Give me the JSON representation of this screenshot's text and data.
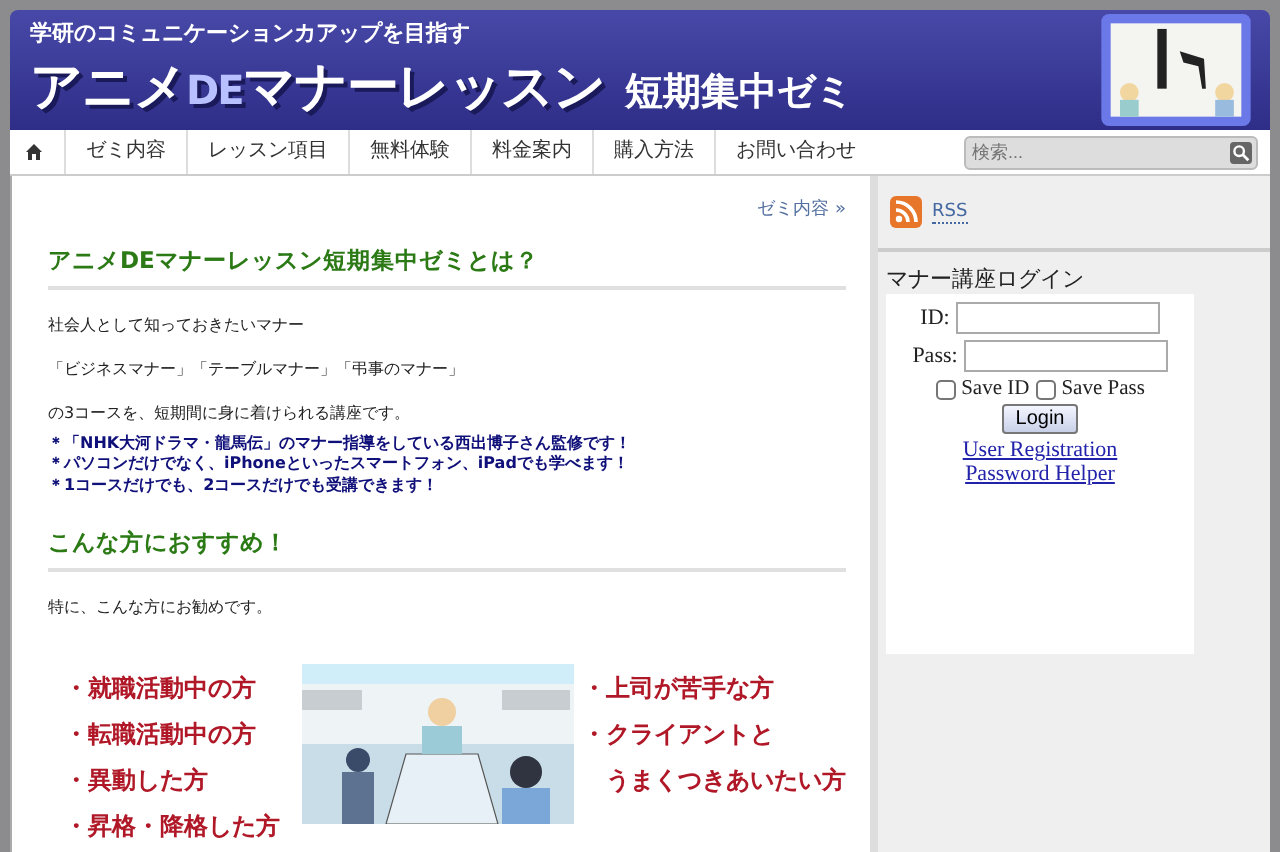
{
  "header": {
    "tagline": "学研のコミュニケーションカアップを目指す",
    "title_part_1": "アニメ",
    "title_part_2": "DE",
    "title_part_3": "マナーレッスン",
    "subtitle": "短期集中ゼミ"
  },
  "nav": {
    "items": [
      {
        "label": "ゼミ内容",
        "selected": false
      },
      {
        "label": "レッスン項目",
        "selected": false
      },
      {
        "label": "無料体験",
        "selected": false
      },
      {
        "label": "料金案内",
        "selected": false
      },
      {
        "label": "購入方法",
        "selected": false
      },
      {
        "label": "お問い合わせ",
        "selected": false
      }
    ],
    "search": {
      "placeholder": "検索..."
    }
  },
  "breadcrumb": "ゼミ内容 »",
  "sections": [
    {
      "heading": "アニメDEマナーレッスン短期集中ゼミとは？",
      "paragraphs": [
        "社会人として知っておきたいマナー",
        "「ビジネスマナー」「テーブルマナー」「弔事のマナー」",
        "の3コースを、短期間に身に着けられる講座です。"
      ],
      "notes": [
        "＊「NHK大河ドラマ・龍馬伝」のマナー指導をしている西出博子さん監修です！",
        "＊パソコンだけでなく、iPhoneといったスマートフォン、iPadでも学べます！",
        "＊1コースだけでも、2コースだけでも受講できます！"
      ]
    },
    {
      "heading": "こんな方におすすめ！",
      "paragraphs": [
        "特に、こんな方にお勧めです。"
      ]
    }
  ],
  "recommend": {
    "left": [
      "・就職活動中の方",
      "・転職活動中の方",
      "・異動した方",
      "・昇格・降格した方"
    ],
    "right": [
      "・上司が苦手な方",
      "・クライアントと",
      "うまくつきあいたい方"
    ]
  },
  "sidebar": {
    "rss": "RSS",
    "login": {
      "title": "マナー講座ログイン",
      "id_label": "ID:",
      "pass_label": "Pass:",
      "save_id": {
        "label": "Save ID",
        "checked": false
      },
      "save_pass": {
        "label": "Save Pass",
        "checked": false
      },
      "button": "Login",
      "links": [
        "User Registration",
        "Password Helper"
      ]
    }
  }
}
